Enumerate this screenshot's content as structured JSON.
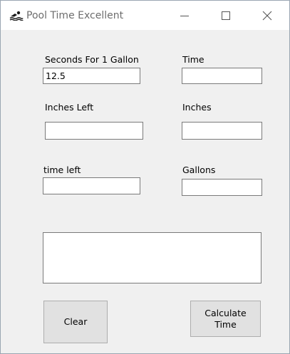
{
  "window": {
    "title": "Pool Time Excellent",
    "app_icon": "swimmer-icon",
    "controls": {
      "minimize": "minimize-icon",
      "maximize": "maximize-icon",
      "close": "close-icon"
    }
  },
  "form": {
    "seconds_label": "Seconds For 1 Gallon",
    "seconds_value": "12.5",
    "time_label": "Time",
    "time_value": "",
    "inches_left_label": "Inches Left",
    "inches_left_value": "",
    "inches_label": "Inches",
    "inches_value": "",
    "time_left_label": "time left",
    "time_left_value": "",
    "gallons_label": "Gallons",
    "gallons_value": "",
    "output_text": ""
  },
  "buttons": {
    "clear": "Clear",
    "calculate": "Calculate\nTime"
  }
}
